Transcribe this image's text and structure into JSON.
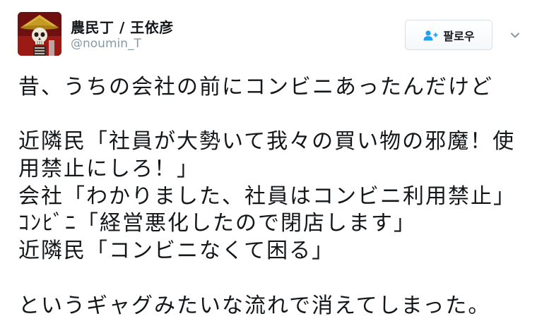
{
  "header": {
    "display_name": "農民丁 / 王依彦",
    "username": "@noumin_T",
    "avatar_icon": "skeleton-avatar"
  },
  "actions": {
    "follow_label": "팔로우",
    "follow_icon": "add-user-icon",
    "more_icon": "chevron-down-icon"
  },
  "tweet": {
    "lines": [
      "昔、うちの会社の前にコンビニあったんだけど",
      "",
      "近隣民「社員が大勢いて我々の買い物の邪魔！使",
      "用禁止にしろ！」",
      "会社「わかりました、社員はコンビニ利用禁止」",
      "ｺﾝﾋﾞﾆ「経営悪化したので閉店します」",
      "近隣民「コンビニなくて困る」",
      "",
      "というギャグみたいな流れで消えてしまった。"
    ]
  },
  "colors": {
    "text": "#14171a",
    "muted": "#8899a6",
    "accent": "#1da1f2",
    "button_border": "#d9dee2"
  }
}
